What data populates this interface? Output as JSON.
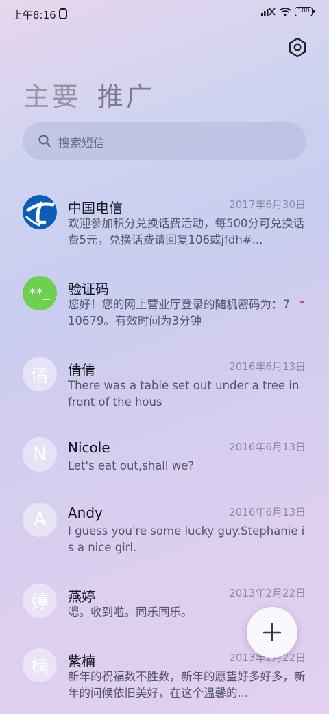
{
  "status_bar": {
    "time": "上午8:16",
    "battery": "100",
    "icons": [
      "phone-icon",
      "signal-icon",
      "wifi-icon",
      "battery-icon"
    ]
  },
  "header": {
    "settings_icon": "settings-hex-icon",
    "tabs": [
      {
        "label": "主要"
      },
      {
        "label": "推广"
      }
    ]
  },
  "search": {
    "placeholder": "搜索短信",
    "icon": "search-icon"
  },
  "conversations": [
    {
      "avatar_type": "logo",
      "avatar_text": "",
      "name": "中国电信",
      "date": "2017年6月30日",
      "preview": "欢迎参加积分兑换话费活动，每500分可兑换话费5元，兑换话费请回复106或jfdh#..."
    },
    {
      "avatar_type": "code",
      "avatar_text": "**_",
      "name": "验证码",
      "date": "",
      "preview": "您好！您的网上营业厅登录的随机密码为：710679。有效时间为3分钟"
    },
    {
      "avatar_type": "letter",
      "avatar_text": "倩",
      "name": "倩倩",
      "date": "2016年6月13日",
      "preview": "There was a table set out under a tree in front of the hous"
    },
    {
      "avatar_type": "letter",
      "avatar_text": "N",
      "name": "Nicole",
      "date": "2016年6月13日",
      "preview": "Let's eat out,shall we?"
    },
    {
      "avatar_type": "letter",
      "avatar_text": "A",
      "name": "Andy",
      "date": "2016年6月13日",
      "preview": "I guess you're some lucky guy.Stephanie is a nice girl."
    },
    {
      "avatar_type": "letter",
      "avatar_text": "婷",
      "name": "燕婷",
      "date": "2013年2月22日",
      "preview": "嗯。收到啦。同乐同乐。"
    },
    {
      "avatar_type": "letter",
      "avatar_text": "楠",
      "name": "紫楠",
      "date": "2013年2月22日",
      "preview": "新年的祝福数不胜数，新年的愿望好多好多，新年的问候依旧美好，在这个温馨的..."
    }
  ],
  "fab": {
    "icon": "plus-icon"
  },
  "colors": {
    "accent_green": "#6fcf51",
    "telecom_blue": "#0b5db8"
  }
}
